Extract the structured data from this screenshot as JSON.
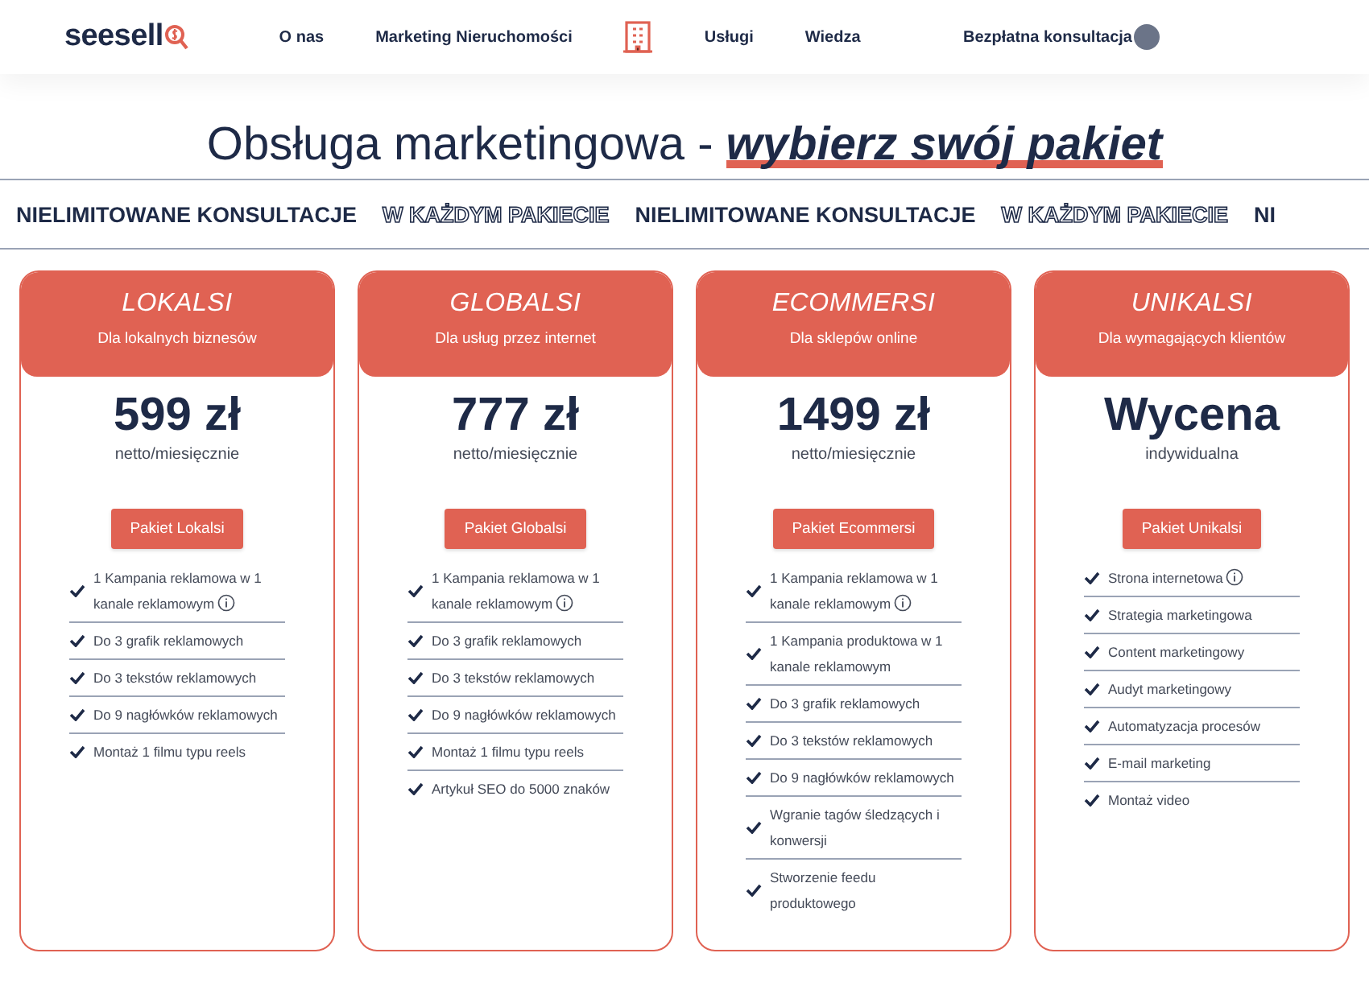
{
  "header": {
    "logo": "seesell",
    "nav": [
      {
        "label": "O nas"
      },
      {
        "label": "Marketing Nieruchomości"
      },
      {
        "kind": "icon"
      },
      {
        "label": "Usługi"
      },
      {
        "label": "Wiedza"
      }
    ],
    "cta": "Bezpłatna konsultacja"
  },
  "title": {
    "plain": "Obsługa marketingowa - ",
    "highlight": "wybierz swój pakiet"
  },
  "marquee": [
    {
      "text": "NIELIMITOWANE KONSULTACJE",
      "kind": "solid"
    },
    {
      "text": "W KAŻDYM PAKIECIE",
      "kind": "outline"
    },
    {
      "text": "NIELIMITOWANE KONSULTACJE",
      "kind": "solid"
    },
    {
      "text": "W KAŻDYM PAKIECIE",
      "kind": "outline"
    },
    {
      "text": "NI",
      "kind": "solid"
    }
  ],
  "plans": [
    {
      "name": "LOKALSI",
      "subtitle": "Dla lokalnych biznesów",
      "price": "599 zł",
      "price_note": "netto/miesięcznie",
      "button": "Pakiet Lokalsi",
      "features": [
        {
          "text": "1 Kampania reklamowa w 1 kanale reklamowym",
          "info": true
        },
        {
          "text": "Do 3 grafik reklamowych",
          "info": false
        },
        {
          "text": "Do 3 tekstów reklamowych",
          "info": false
        },
        {
          "text": "Do 9 nagłówków reklamowych",
          "info": false
        },
        {
          "text": "Montaż 1 filmu typu reels",
          "info": false
        }
      ]
    },
    {
      "name": "GLOBALSI",
      "subtitle": "Dla usług przez internet",
      "price": "777 zł",
      "price_note": "netto/miesięcznie",
      "button": "Pakiet Globalsi",
      "features": [
        {
          "text": "1 Kampania reklamowa w 1 kanale reklamowym",
          "info": true
        },
        {
          "text": "Do 3 grafik reklamowych",
          "info": false
        },
        {
          "text": "Do 3 tekstów reklamowych",
          "info": false
        },
        {
          "text": "Do 9 nagłówków reklamowych",
          "info": false
        },
        {
          "text": "Montaż 1 filmu typu reels",
          "info": false
        },
        {
          "text": "Artykuł SEO do 5000 znaków",
          "info": false
        }
      ]
    },
    {
      "name": "ECOMMERSI",
      "subtitle": "Dla sklepów online",
      "price": "1499 zł",
      "price_note": "netto/miesięcznie",
      "button": "Pakiet Ecommersi",
      "features": [
        {
          "text": "1 Kampania reklamowa w 1 kanale reklamowym",
          "info": true
        },
        {
          "text": "1 Kampania produktowa w 1 kanale reklamowym",
          "info": false
        },
        {
          "text": "Do 3 grafik reklamowych",
          "info": false
        },
        {
          "text": "Do 3 tekstów reklamowych",
          "info": false
        },
        {
          "text": "Do 9 nagłówków reklamowych",
          "info": false
        },
        {
          "text": "Wgranie tagów śledzących i konwersji",
          "info": false
        },
        {
          "text": "Stworzenie feedu produktowego",
          "info": false
        }
      ]
    },
    {
      "name": "UNIKALSI",
      "subtitle": "Dla wymagających klientów",
      "price": "Wycena",
      "price_note": "indywidualna",
      "button": "Pakiet Unikalsi",
      "features": [
        {
          "text": "Strona internetowa",
          "info": true
        },
        {
          "text": "Strategia marketingowa",
          "info": false
        },
        {
          "text": "Content marketingowy",
          "info": false
        },
        {
          "text": "Audyt marketingowy",
          "info": false
        },
        {
          "text": "Automatyzacja procesów",
          "info": false
        },
        {
          "text": "E-mail marketing",
          "info": false
        },
        {
          "text": "Montaż video",
          "info": false
        }
      ]
    }
  ]
}
